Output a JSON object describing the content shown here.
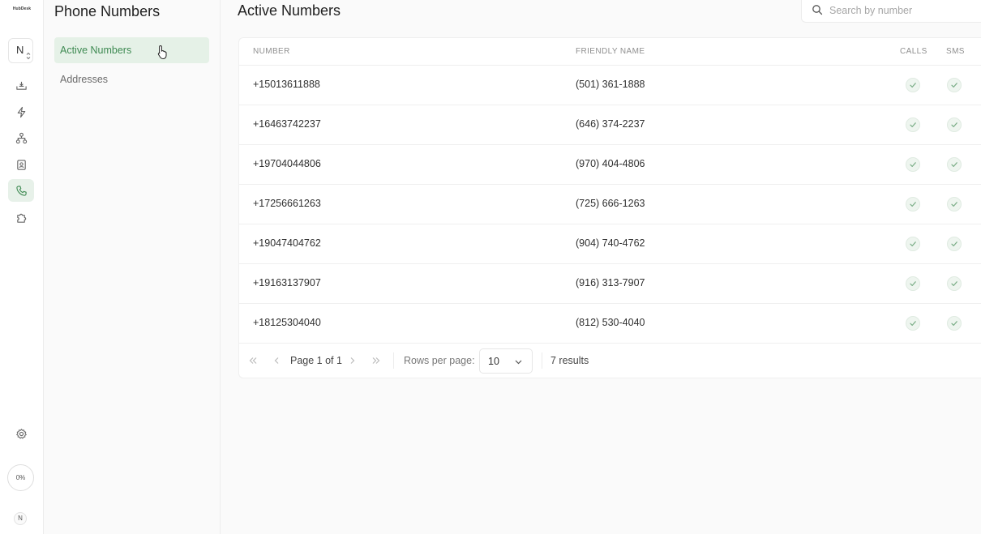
{
  "app": {
    "logo_text": "HubDesk",
    "workspace_initial": "N",
    "usage_percent": "0%",
    "user_initial": "N",
    "accent_color": "#3e8a52"
  },
  "rail": {
    "items": [
      {
        "name": "inbox-icon"
      },
      {
        "name": "lightning-icon"
      },
      {
        "name": "flow-icon"
      },
      {
        "name": "contact-icon"
      },
      {
        "name": "phone-icon",
        "active": true
      },
      {
        "name": "puzzle-icon"
      }
    ],
    "settings_icon": "gear-icon"
  },
  "subnav": {
    "title": "Phone Numbers",
    "items": [
      {
        "label": "Active Numbers",
        "active": true
      },
      {
        "label": "Addresses",
        "active": false
      }
    ]
  },
  "main": {
    "title": "Active Numbers",
    "search": {
      "placeholder": "Search by number",
      "value": ""
    },
    "table": {
      "columns": [
        "NUMBER",
        "FRIENDLY NAME",
        "CALLS",
        "SMS"
      ],
      "rows": [
        {
          "number": "+15013611888",
          "friendly_name": "(501) 361-1888",
          "calls": true,
          "sms": true
        },
        {
          "number": "+16463742237",
          "friendly_name": "(646) 374-2237",
          "calls": true,
          "sms": true
        },
        {
          "number": "+19704044806",
          "friendly_name": "(970) 404-4806",
          "calls": true,
          "sms": true
        },
        {
          "number": "+17256661263",
          "friendly_name": "(725) 666-1263",
          "calls": true,
          "sms": true
        },
        {
          "number": "+19047404762",
          "friendly_name": "(904) 740-4762",
          "calls": true,
          "sms": true
        },
        {
          "number": "+19163137907",
          "friendly_name": "(916) 313-7907",
          "calls": true,
          "sms": true
        },
        {
          "number": "+18125304040",
          "friendly_name": "(812) 530-4040",
          "calls": true,
          "sms": true
        }
      ]
    },
    "pagination": {
      "page_label": "Page 1 of 1",
      "rows_per_page_label": "Rows per page:",
      "rows_per_page": "10",
      "results": "7 results"
    }
  }
}
